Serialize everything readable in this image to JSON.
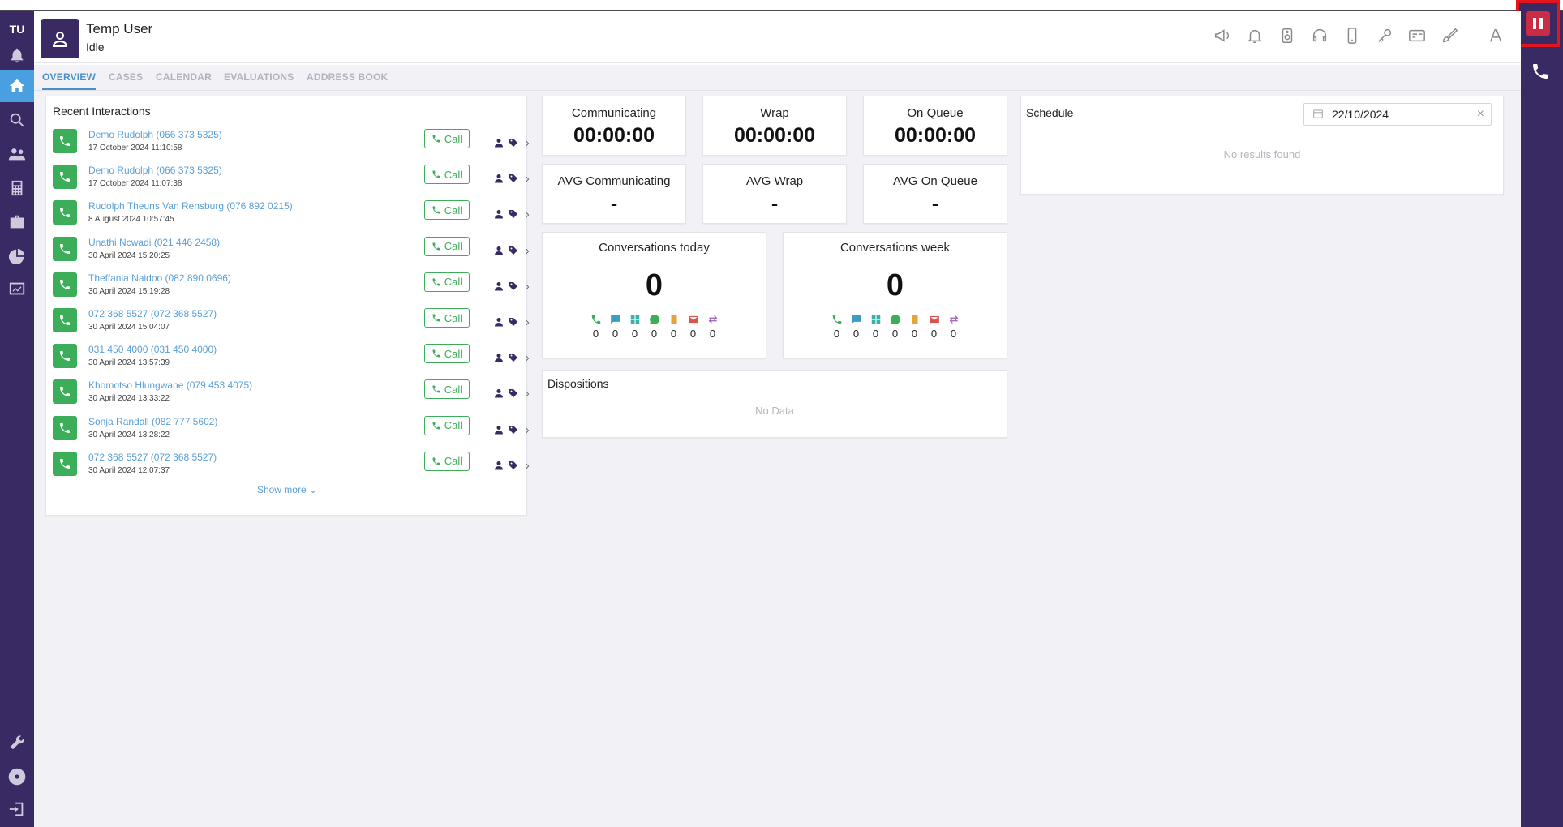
{
  "user": {
    "initials": "TU",
    "name": "Temp User",
    "status": "Idle"
  },
  "tabs": [
    "OVERVIEW",
    "CASES",
    "CALENDAR",
    "EVALUATIONS",
    "ADDRESS BOOK"
  ],
  "recent": {
    "title": "Recent Interactions",
    "call_label": "Call",
    "show_more": "Show more",
    "items": [
      {
        "name": "Demo Rudolph (066 373 5325)",
        "date": "17 October 2024 11:10:58"
      },
      {
        "name": "Demo Rudolph (066 373 5325)",
        "date": "17 October 2024 11:07:38"
      },
      {
        "name": "Rudolph Theuns Van Rensburg (076 892 0215)",
        "date": "8 August 2024 10:57:45"
      },
      {
        "name": "Unathi Ncwadi (021 446 2458)",
        "date": "30 April 2024 15:20:25"
      },
      {
        "name": "Theffania Naidoo (082 890 0696)",
        "date": "30 April 2024 15:19:28"
      },
      {
        "name": "072 368 5527 (072 368 5527)",
        "date": "30 April 2024 15:04:07"
      },
      {
        "name": "031 450 4000 (031 450 4000)",
        "date": "30 April 2024 13:57:39"
      },
      {
        "name": "Khomotso Hlungwane (079 453 4075)",
        "date": "30 April 2024 13:33:22"
      },
      {
        "name": "Sonja Randall (082 777 5602)",
        "date": "30 April 2024 13:28:22"
      },
      {
        "name": "072 368 5527 (072 368 5527)",
        "date": "30 April 2024 12:07:37"
      }
    ]
  },
  "stats": {
    "communicating": {
      "label": "Communicating",
      "value": "00:00:00"
    },
    "wrap": {
      "label": "Wrap",
      "value": "00:00:00"
    },
    "on_queue": {
      "label": "On Queue",
      "value": "00:00:00"
    },
    "avg_communicating": {
      "label": "AVG Communicating",
      "value": "-"
    },
    "avg_wrap": {
      "label": "AVG Wrap",
      "value": "-"
    },
    "avg_on_queue": {
      "label": "AVG On Queue",
      "value": "-"
    }
  },
  "conversations": {
    "today": {
      "label": "Conversations today",
      "total": "0",
      "channels": [
        "0",
        "0",
        "0",
        "0",
        "0",
        "0",
        "0"
      ]
    },
    "week": {
      "label": "Conversations week",
      "total": "0",
      "channels": [
        "0",
        "0",
        "0",
        "0",
        "0",
        "0",
        "0"
      ]
    }
  },
  "dispositions": {
    "title": "Dispositions",
    "empty": "No Data"
  },
  "schedule": {
    "title": "Schedule",
    "date": "22/10/2024",
    "empty": "No results found"
  },
  "colors": {
    "sidebar": "#3a2a63",
    "accent": "#4a90c8",
    "green": "#3cae5a",
    "pause": "#c92c44",
    "highlight": "#e3141c"
  }
}
